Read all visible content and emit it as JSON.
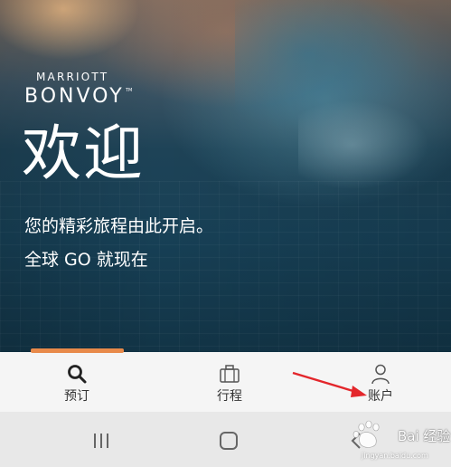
{
  "hero": {
    "brand_top": "MARRIOTT",
    "brand_main": "BONVOY",
    "brand_tm": "TM",
    "welcome": "欢迎",
    "tagline": "您的精彩旅程由此开启。",
    "global": "全球 GO 就现在"
  },
  "bottom_nav": {
    "items": [
      {
        "label": "预订",
        "icon": "search-icon",
        "active": true
      },
      {
        "label": "行程",
        "icon": "briefcase-icon",
        "active": false
      },
      {
        "label": "账户",
        "icon": "person-icon",
        "active": false
      }
    ]
  },
  "system_nav": {
    "items": [
      "recents-icon",
      "home-icon",
      "back-icon"
    ]
  },
  "watermark": {
    "text": "Bai 经验",
    "url": "jingyan.baidu.com"
  },
  "colors": {
    "active_indicator": "#e88a4a",
    "annotation_arrow": "#e3262b",
    "nav_background": "#f5f5f5",
    "system_nav_background": "#e8e8e8"
  }
}
